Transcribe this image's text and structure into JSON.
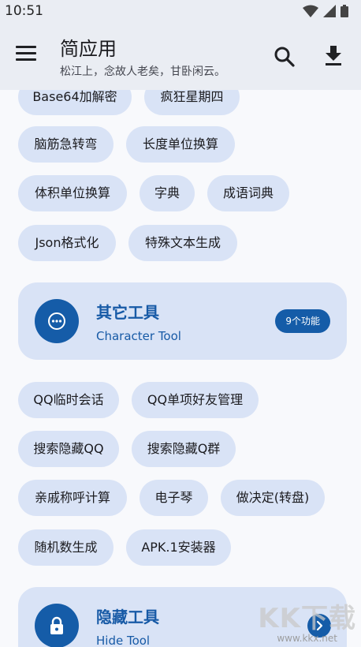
{
  "status": {
    "time": "10:51"
  },
  "appbar": {
    "title": "简应用",
    "subtitle": "松江上，念故人老矣，甘卧闲云。"
  },
  "chips_group1": [
    "Base64加解密",
    "疯狂星期四",
    "脑筋急转弯",
    "长度单位换算",
    "体积单位换算",
    "字典",
    "成语词典",
    "Json格式化",
    "特殊文本生成"
  ],
  "card_other": {
    "name": "其它工具",
    "en": "Character Tool",
    "badge": "9个功能"
  },
  "chips_group2": [
    "QQ临时会话",
    "QQ单项好友管理",
    "搜索隐藏QQ",
    "搜索隐藏Q群",
    "亲戚称呼计算",
    "电子琴",
    "做决定(转盘)",
    "随机数生成",
    "APK.1安装器"
  ],
  "card_hide": {
    "name": "隐藏工具",
    "en": "Hide Tool"
  },
  "watermark": {
    "logo_text": "KK下载",
    "url": "www.kkx.net"
  },
  "colors": {
    "accent": "#155ca8",
    "chip_bg": "#d9e3f6",
    "appbar_bg": "#eaedf3",
    "background": "#f8f9fc"
  }
}
